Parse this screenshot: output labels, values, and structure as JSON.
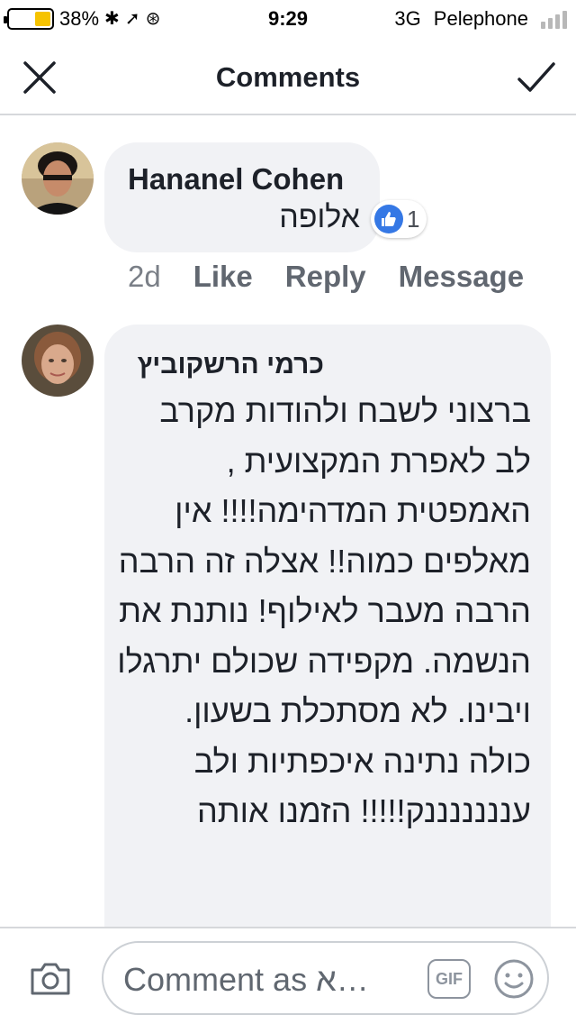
{
  "status_bar": {
    "battery_percent": "38%",
    "battery_level": 0.38,
    "time": "9:29",
    "network": "3G",
    "carrier": "Pelephone"
  },
  "nav": {
    "title": "Comments"
  },
  "comments": [
    {
      "author": "Hananel Cohen",
      "text": "אלופה",
      "reaction_count": "1",
      "time": "2d",
      "actions": [
        "Like",
        "Reply",
        "Message"
      ]
    },
    {
      "author": "כרמי הרשקוביץ",
      "text": "ברצוני לשבח ולהודות מקרב לב לאפרת המקצועית , האמפטית המדהימה!!!! אין מאלפים כמוה!! אצלה זה הרבה הרבה מעבר לאילוף! נותנת את הנשמה. מקפידה שכולם יתרגלו ויבינו. לא מסתכלת בשעון. כולה נתינה איכפתיות ולב ענננננננק!!!!! הזמנו אותה"
    }
  ],
  "composer": {
    "placeholder": "Comment as א…",
    "gif_label": "GIF"
  },
  "icons": {
    "close": "close-icon",
    "check": "check-icon",
    "camera": "camera-icon",
    "emoji": "emoji-icon",
    "like": "thumbs-up-icon"
  },
  "colors": {
    "like_blue": "#3578e5",
    "bubble": "#f1f2f5",
    "battery_fill": "#f6c300"
  }
}
